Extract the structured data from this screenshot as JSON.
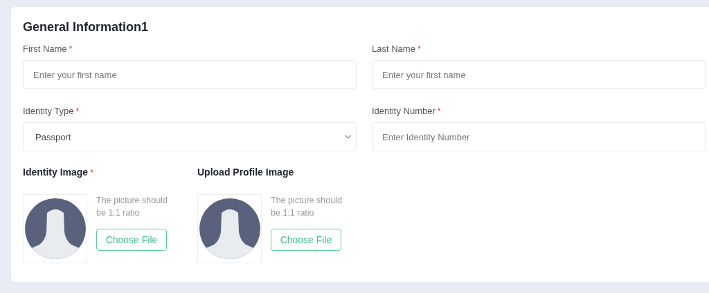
{
  "title": "General Information1",
  "fields": [
    {
      "label": "First Name",
      "required_mark": "*",
      "kind": "input",
      "placeholder": "Enter your first name"
    },
    {
      "label": "Last Name",
      "required_mark": "*",
      "kind": "input",
      "placeholder": "Enter your first name"
    },
    {
      "label": "Identity Type",
      "required_mark": "*",
      "kind": "select",
      "value": "Passport"
    },
    {
      "label": "Identity Number",
      "required_mark": "*",
      "kind": "input",
      "placeholder": "Enter Identity Number"
    }
  ],
  "uploads": [
    {
      "heading": "Identity Image",
      "required_mark": "*",
      "hint": "The picture should be 1:1 ratio",
      "button": "Choose File"
    },
    {
      "heading": "Upload Profile Image",
      "hint": "The picture should be 1:1 ratio",
      "button": "Choose File"
    }
  ]
}
